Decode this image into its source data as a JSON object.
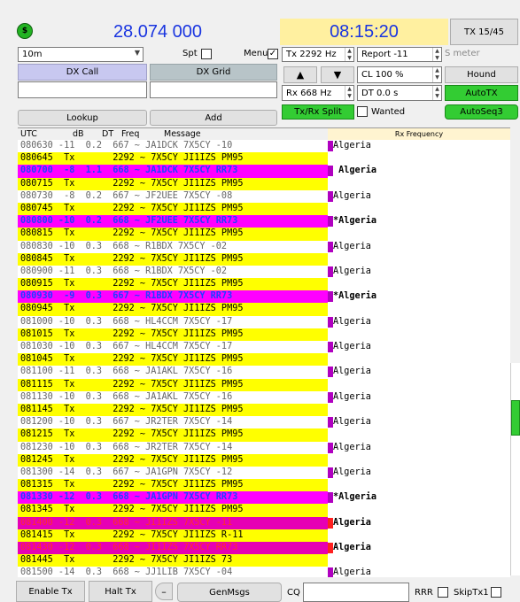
{
  "status": {
    "icon_label": "$",
    "frequency": "28.074 000",
    "time": "08:15:20",
    "tx_status": "TX 15/45"
  },
  "band": {
    "value": "10m"
  },
  "spt": {
    "label": "Spt"
  },
  "menu": {
    "label": "Menu",
    "checked": "✓"
  },
  "tx_freq": {
    "label": "Tx",
    "value": "2292",
    "unit": "Hz"
  },
  "report": {
    "value": "Report -11"
  },
  "smeter": {
    "label": "S meter"
  },
  "dx": {
    "call_header": "DX Call",
    "grid_header": "DX Grid",
    "call_value": "",
    "grid_value": ""
  },
  "arrows": {
    "up": "▲",
    "down": "▼"
  },
  "cl": {
    "value": "CL  100 %"
  },
  "hound": {
    "label": "Hound"
  },
  "rx_freq": {
    "label": "Rx",
    "value": "668",
    "unit": "Hz"
  },
  "dt": {
    "value": "DT 0.0 s"
  },
  "autotx": {
    "label": "AutoTX"
  },
  "lookup": {
    "label": "Lookup"
  },
  "add": {
    "label": "Add"
  },
  "split": {
    "label": "Tx/Rx Split"
  },
  "wanted": {
    "label": "Wanted"
  },
  "autoseq": {
    "label": "AutoSeq3"
  },
  "rx_frequency_label": "Rx Frequency",
  "table": {
    "headers": {
      "utc": "UTC",
      "db": "dB",
      "dt": "DT",
      "freq": "Freq",
      "message": "Message"
    },
    "rows": [
      {
        "type": "rx",
        "text": "080630 -11  0.2  667 ~ JA1DCK 7X5CY -10",
        "country": "Algeria"
      },
      {
        "type": "tx",
        "text": "080645  Tx       2292 ~ 7X5CY JI1IZS PM95",
        "country": ""
      },
      {
        "type": "me",
        "text": "080700  -8  1.1  668 ~ JA1DCK 7X5CY RR73",
        "country": " Algeria"
      },
      {
        "type": "tx",
        "text": "080715  Tx       2292 ~ 7X5CY JI1IZS PM95",
        "country": ""
      },
      {
        "type": "rx",
        "text": "080730  -8  0.2  667 ~ JF2UEE 7X5CY -08",
        "country": "Algeria"
      },
      {
        "type": "tx",
        "text": "080745  Tx       2292 ~ 7X5CY JI1IZS PM95",
        "country": ""
      },
      {
        "type": "me",
        "text": "080800 -10  0.2  668 ~ JF2UEE 7X5CY RR73",
        "country": "*Algeria"
      },
      {
        "type": "tx",
        "text": "080815  Tx       2292 ~ 7X5CY JI1IZS PM95",
        "country": ""
      },
      {
        "type": "rx",
        "text": "080830 -10  0.3  668 ~ R1BDX 7X5CY -02",
        "country": "Algeria"
      },
      {
        "type": "tx",
        "text": "080845  Tx       2292 ~ 7X5CY JI1IZS PM95",
        "country": ""
      },
      {
        "type": "rx",
        "text": "080900 -11  0.3  668 ~ R1BDX 7X5CY -02",
        "country": "Algeria"
      },
      {
        "type": "tx",
        "text": "080915  Tx       2292 ~ 7X5CY JI1IZS PM95",
        "country": ""
      },
      {
        "type": "me",
        "text": "080930  -9  0.3  667 ~ R1BDX 7X5CY RR73",
        "country": "*Algeria"
      },
      {
        "type": "tx",
        "text": "080945  Tx       2292 ~ 7X5CY JI1IZS PM95",
        "country": ""
      },
      {
        "type": "rx",
        "text": "081000 -10  0.3  668 ~ HL4CCM 7X5CY -17",
        "country": "Algeria"
      },
      {
        "type": "tx",
        "text": "081015  Tx       2292 ~ 7X5CY JI1IZS PM95",
        "country": ""
      },
      {
        "type": "rx",
        "text": "081030 -10  0.3  667 ~ HL4CCM 7X5CY -17",
        "country": "Algeria"
      },
      {
        "type": "tx",
        "text": "081045  Tx       2292 ~ 7X5CY JI1IZS PM95",
        "country": ""
      },
      {
        "type": "rx",
        "text": "081100 -11  0.3  668 ~ JA1AKL 7X5CY -16",
        "country": "Algeria"
      },
      {
        "type": "tx",
        "text": "081115  Tx       2292 ~ 7X5CY JI1IZS PM95",
        "country": ""
      },
      {
        "type": "rx",
        "text": "081130 -10  0.3  668 ~ JA1AKL 7X5CY -16",
        "country": "Algeria"
      },
      {
        "type": "tx",
        "text": "081145  Tx       2292 ~ 7X5CY JI1IZS PM95",
        "country": ""
      },
      {
        "type": "rx",
        "text": "081200 -10  0.3  667 ~ JR2TER 7X5CY -14",
        "country": "Algeria"
      },
      {
        "type": "tx",
        "text": "081215  Tx       2292 ~ 7X5CY JI1IZS PM95",
        "country": ""
      },
      {
        "type": "rx",
        "text": "081230 -10  0.3  668 ~ JR2TER 7X5CY -14",
        "country": "Algeria"
      },
      {
        "type": "tx",
        "text": "081245  Tx       2292 ~ 7X5CY JI1IZS PM95",
        "country": ""
      },
      {
        "type": "rx",
        "text": "081300 -14  0.3  667 ~ JA1GPN 7X5CY -12",
        "country": "Algeria"
      },
      {
        "type": "tx",
        "text": "081315  Tx       2292 ~ 7X5CY JI1IZS PM95",
        "country": ""
      },
      {
        "type": "me",
        "text": "081330 -12  0.3  668 ~ JA1GPN 7X5CY RR73",
        "country": "*Algeria"
      },
      {
        "type": "tx",
        "text": "081345  Tx       2292 ~ 7X5CY JI1IZS PM95",
        "country": ""
      },
      {
        "type": "alert",
        "text": "081400 -12  0.3  668 ~ JI1IZS 7X5CY -11",
        "country": "Algeria"
      },
      {
        "type": "tx",
        "text": "081415  Tx       2292 ~ 7X5CY JI1IZS R-11",
        "country": ""
      },
      {
        "type": "alert",
        "text": "081430 -12  0.3  668 ~ JI1IZS 7X5CY RR73",
        "country": "Algeria"
      },
      {
        "type": "tx",
        "text": "081445  Tx       2292 ~ 7X5CY JI1IZS 73",
        "country": ""
      },
      {
        "type": "rx",
        "text": "081500 -14  0.3  668 ~ JJ1LIB 7X5CY -04",
        "country": "Algeria"
      }
    ]
  },
  "bottom": {
    "enable_tx": "Enable Tx",
    "halt_tx": "Halt Tx",
    "genmsgs": "GenMsgs",
    "cq_label": "CQ",
    "rrr_label": "RRR",
    "skiptx_label": "SkipTx1"
  },
  "colors": {
    "tx_row": "#ffff00",
    "my_qso_row": "#ff00ff",
    "alert_row": "#e600b4",
    "green": "#33cc33",
    "time_bg": "#fff0a0"
  }
}
